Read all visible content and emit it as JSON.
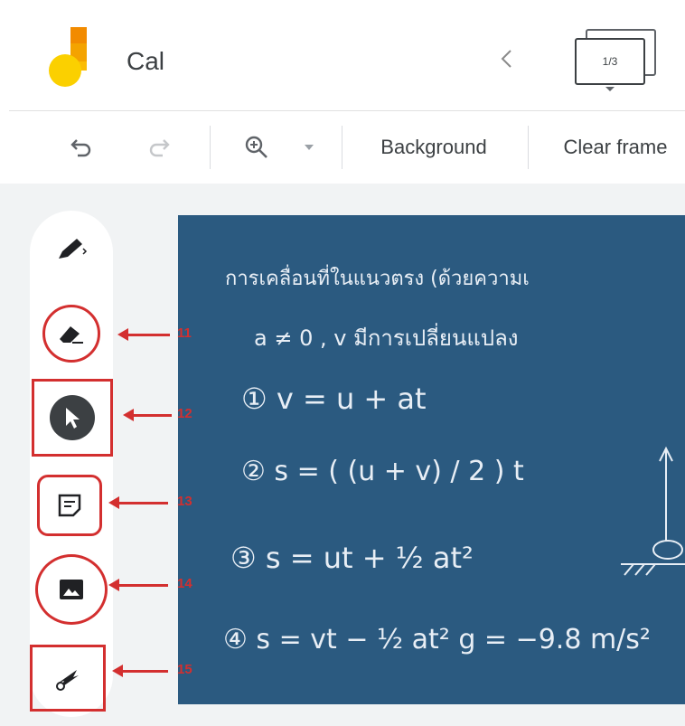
{
  "header": {
    "title": "Cal",
    "frame_counter": "1/3"
  },
  "toolbar": {
    "background_label": "Background",
    "clear_frame_label": "Clear frame"
  },
  "tools": [
    {
      "name": "pen",
      "icon": "pen-icon"
    },
    {
      "name": "eraser",
      "icon": "eraser-icon",
      "annotation": "11"
    },
    {
      "name": "select",
      "icon": "pointer-icon",
      "annotation": "12"
    },
    {
      "name": "sticky-note",
      "icon": "sticky-note-icon",
      "annotation": "13"
    },
    {
      "name": "image",
      "icon": "image-icon",
      "annotation": "14"
    },
    {
      "name": "laser",
      "icon": "laser-icon",
      "annotation": "15"
    }
  ],
  "board": {
    "lines": [
      "การเคลื่อนที่ในแนวตรง (ด้วยความเ",
      "a ≠ 0 , v มีการเปลี่ยนแปลง",
      "① v = u + at",
      "② s = ( (u + v) / 2 ) t",
      "③ s = ut + ½ at²",
      "④ s = vt − ½ at²    g = −9.8 m/s²"
    ]
  },
  "colors": {
    "accent": "#d32f2f",
    "board": "#2b5a80",
    "logo_orange": "#f4a300",
    "logo_yellow": "#fbd000"
  }
}
